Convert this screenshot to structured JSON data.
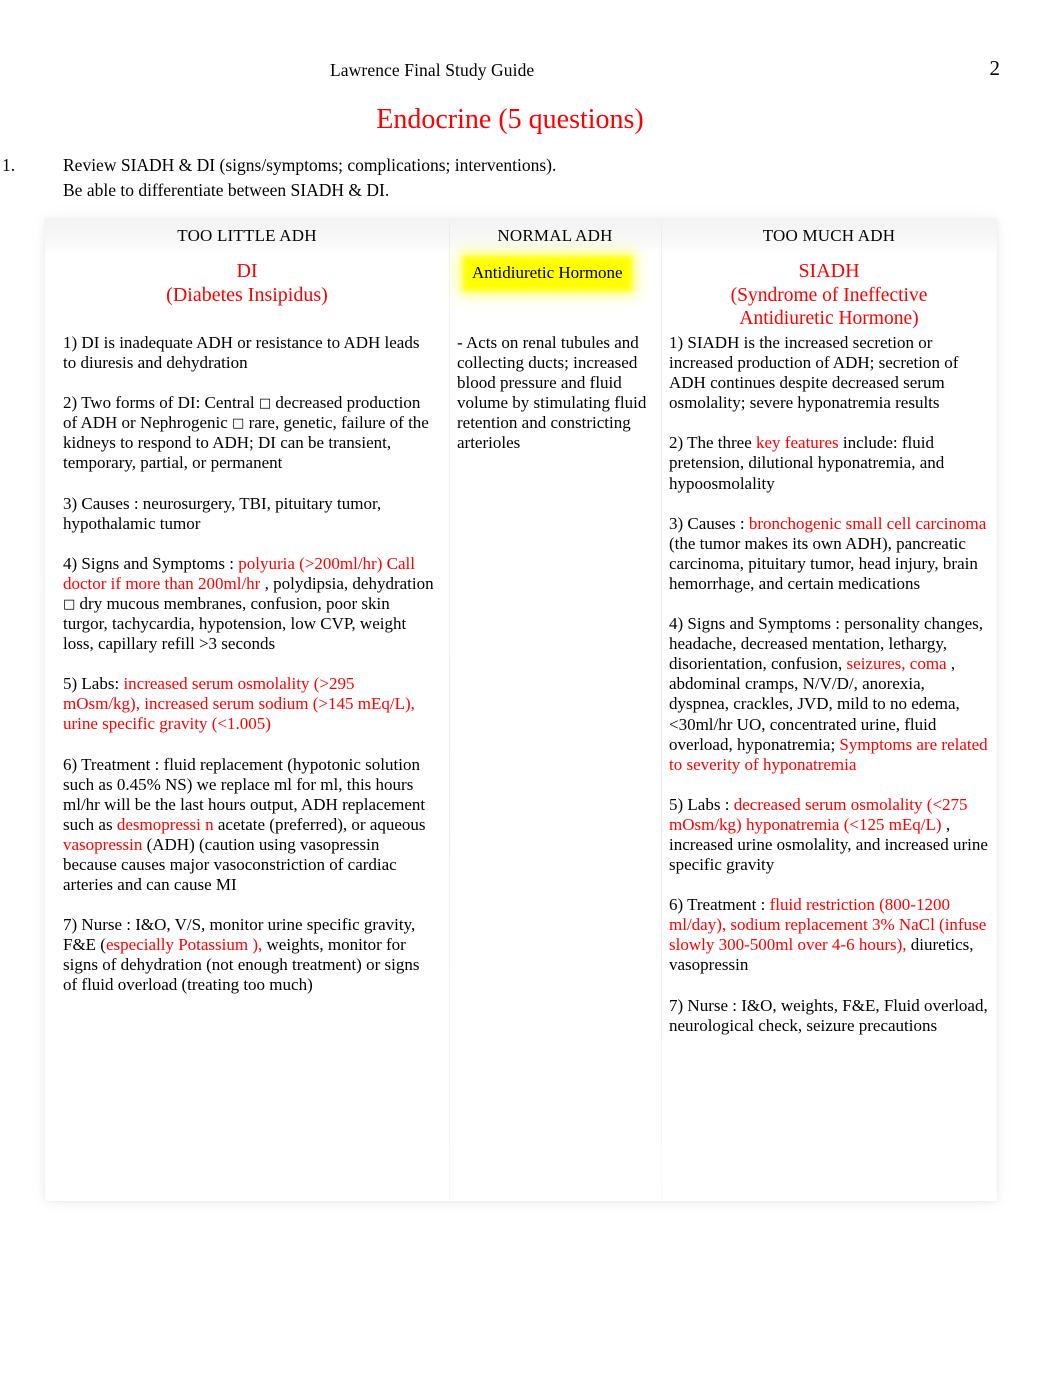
{
  "header": {
    "running_title": "Lawrence Final Study Guide",
    "page_number": "2",
    "doc_title": "Endocrine (5 questions)"
  },
  "instruction": {
    "number": "1.",
    "line1": "Review SIADH & DI (signs/symptoms; complications; interventions).",
    "line2": "Be able to differentiate between SIADH & DI."
  },
  "colors": {
    "accent_red": "#ff0000",
    "highlight_yellow": "#ffff00",
    "header_band": "#f5f5f5",
    "text": "#000000"
  },
  "table": {
    "columns": [
      {
        "head": "TOO LITTLE ADH",
        "title_lines": [
          "DI",
          "(Diabetes Insipidus)"
        ],
        "title_color": "#ff0000",
        "highlighted": false
      },
      {
        "head": "NORMAL ADH",
        "title_lines": [
          "Antidiuretic Hormone"
        ],
        "title_color": "#000000",
        "highlighted": true
      },
      {
        "head": "TOO MUCH ADH",
        "title_lines": [
          "SIADH",
          "(Syndrome of Ineffective",
          "Antidiuretic Hormone)"
        ],
        "title_color": "#ff0000",
        "highlighted": false
      }
    ],
    "left_column": {
      "items": [
        {
          "label": "1) DI is inadequate ADH or resistance to ADH leads to diuresis and dehydration",
          "parts": [
            {
              "text": "1) DI is inadequate ADH or resistance to ADH leads to diuresis and dehydration",
              "color": "black"
            }
          ]
        },
        {
          "label": "2) Two forms of DI",
          "parts": [
            {
              "text": "2) Two forms of DI: Central ",
              "color": "black"
            },
            {
              "text": "□",
              "color": "black",
              "style": "box"
            },
            {
              "text": " decreased production of ADH or Nephrogenic ",
              "color": "black"
            },
            {
              "text": "□",
              "color": "black",
              "style": "box"
            },
            {
              "text": " rare, genetic, failure of the kidneys to respond to ADH; DI can be transient, temporary, partial, or permanent",
              "color": "black"
            }
          ]
        },
        {
          "label": "3) Causes",
          "parts": [
            {
              "text": "3) Causes",
              "color": "black"
            },
            {
              "text": " : neurosurgery, TBI, pituitary tumor, hypothalamic tumor",
              "color": "black"
            }
          ]
        },
        {
          "label": "4) Signs and Symptoms",
          "parts": [
            {
              "text": "4) Signs and Symptoms",
              "color": "black"
            },
            {
              "text": " : ",
              "color": "black"
            },
            {
              "text": "polyuria (>200ml/hr) Call doctor if more than 200ml/hr",
              "color": "red"
            },
            {
              "text": " , polydipsia, dehydration ",
              "color": "black"
            },
            {
              "text": "□",
              "color": "black",
              "style": "box"
            },
            {
              "text": " dry mucous membranes, confusion, poor skin turgor, tachycardia, hypotension, low CVP, weight loss, capillary refill >3 seconds",
              "color": "black"
            }
          ]
        },
        {
          "label": "5) Labs",
          "parts": [
            {
              "text": "5) Labs:  ",
              "color": "black"
            },
            {
              "text": "increased serum osmolality (>295 mOsm/kg), increased serum sodium (>145 mEq/L), urine specific gravity (<1.005)",
              "color": "red"
            }
          ]
        },
        {
          "label": "6) Treatment",
          "parts": [
            {
              "text": "6) Treatment",
              "color": "black"
            },
            {
              "text": " : fluid replacement",
              "color": "black"
            },
            {
              "text": " (hypotonic solution such as 0.45% NS) we replace ml for ml, this hours ml/hr will be the last hours output, ADH replacement such as",
              "color": "black"
            },
            {
              "text": " desmopressi",
              "color": "red"
            },
            {
              "text": " n",
              "color": "red"
            },
            {
              "text": " acetate (preferred), or aqueous",
              "color": "black"
            },
            {
              "text": " vasopressin",
              "color": "red"
            },
            {
              "text": " (ADH) (caution using vasopressin because causes major vasoconstriction of cardiac arteries and can cause MI",
              "color": "black"
            }
          ]
        },
        {
          "label": "7) Nurse",
          "parts": [
            {
              "text": "7) Nurse",
              "color": "black"
            },
            {
              "text": " : I&O, V/S, monitor urine specific gravity,  F&E (",
              "color": "black"
            },
            {
              "text": "especially Potassium",
              "color": "red"
            },
            {
              "text": " ),",
              "color": "red"
            },
            {
              "text": " weights, monitor for signs of dehydration (not enough treatment) or signs of fluid overload (treating too much)",
              "color": "black"
            }
          ]
        }
      ]
    },
    "middle_column": {
      "items": [
        {
          "label": "ADH action",
          "parts": [
            {
              "text": "- Acts on renal tubules and collecting ducts; increased blood pressure and fluid volume by stimulating fluid retention and constricting arterioles",
              "color": "black"
            }
          ]
        }
      ]
    },
    "right_column": {
      "items": [
        {
          "label": "1) SIADH definition",
          "parts": [
            {
              "text": "1) SIADH is the increased secretion or increased production of ADH; secretion of ADH continues despite decreased serum osmolality; severe hyponatremia results",
              "color": "black"
            }
          ]
        },
        {
          "label": "2) The three key features",
          "parts": [
            {
              "text": "2) The three ",
              "color": "black"
            },
            {
              "text": "key features",
              "color": "red"
            },
            {
              "text": " include: fluid pretension, dilutional hyponatremia, and hypoosmolality",
              "color": "black"
            }
          ]
        },
        {
          "label": "3) Causes",
          "parts": [
            {
              "text": "3) Causes",
              "color": "black"
            },
            {
              "text": " : ",
              "color": "black"
            },
            {
              "text": "bronchogenic small cell carcinoma",
              "color": "red"
            },
            {
              "text": " (the tumor makes its own ADH), pancreatic carcinoma, pituitary tumor, head injury, brain hemorrhage, and certain medications",
              "color": "black"
            }
          ]
        },
        {
          "label": "4) Signs and Symptoms",
          "parts": [
            {
              "text": "4) Signs and Symptoms",
              "color": "black"
            },
            {
              "text": " : personality changes, headache, decreased mentation, lethargy, disorientation, confusion, ",
              "color": "black"
            },
            {
              "text": "seizures, coma",
              "color": "red"
            },
            {
              "text": " , abdominal cramps, N/V/D/, anorexia, dyspnea, crackles, JVD, mild to no edema, <30ml/hr UO, concentrated urine, fluid overload, hyponatremia; ",
              "color": "black"
            },
            {
              "text": "Symptoms are related to severity of hyponatremia",
              "color": "red"
            }
          ]
        },
        {
          "label": "5) Labs",
          "parts": [
            {
              "text": "5) Labs",
              "color": "black"
            },
            {
              "text": " : ",
              "color": "black"
            },
            {
              "text": "decreased serum osmolality (<275 mOsm/kg) hyponatremia (<125 mEq/L)",
              "color": "red"
            },
            {
              "text": " , increased urine osmolality, and increased urine specific gravity",
              "color": "black"
            }
          ]
        },
        {
          "label": "6) Treatment",
          "parts": [
            {
              "text": "6) Treatment",
              "color": "black"
            },
            {
              "text": " : ",
              "color": "black"
            },
            {
              "text": "fluid restriction (800-1200 ml/day), sodium replacement 3% NaCl (infuse slowly 300-500ml over 4-6 hours),",
              "color": "red"
            },
            {
              "text": " diuretics, vasopressin",
              "color": "black"
            }
          ]
        },
        {
          "label": "7) Nurse",
          "parts": [
            {
              "text": "7) Nurse",
              "color": "black"
            },
            {
              "text": " : I&O, weights, F&E, Fluid overload, neurological check, ",
              "color": "black"
            },
            {
              "text": " seizure precautions",
              "color": "black"
            }
          ]
        }
      ]
    }
  }
}
